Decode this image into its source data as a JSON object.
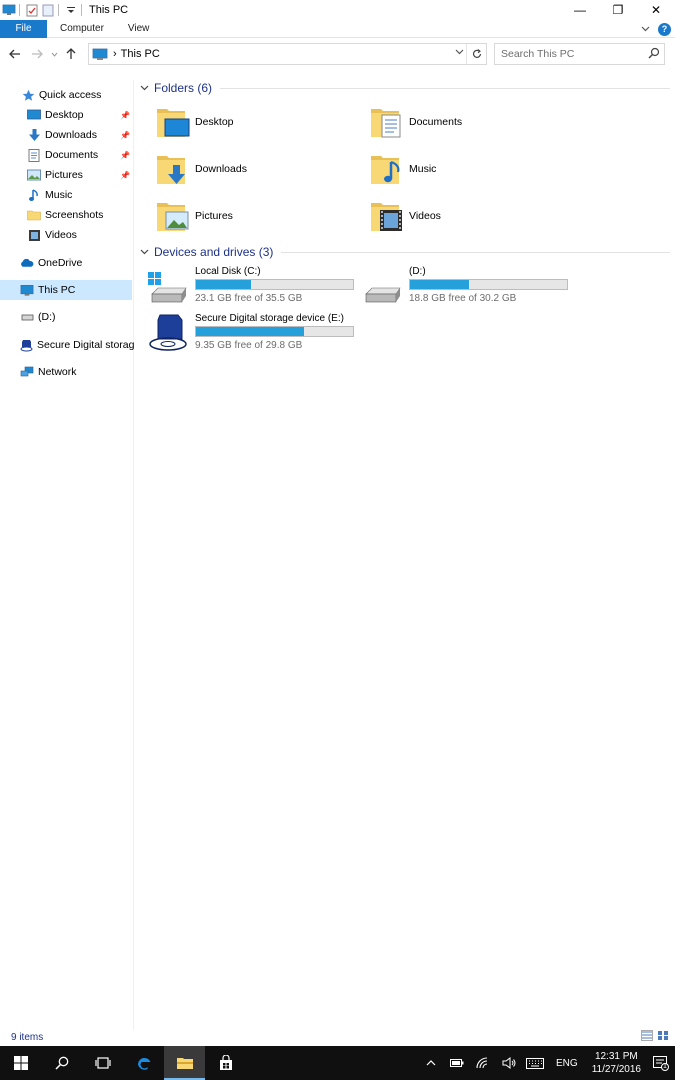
{
  "window": {
    "title": "This PC",
    "minimize_glyph": "—",
    "restore_glyph": "❐",
    "close_glyph": "✕"
  },
  "ribbon": {
    "tabs": [
      "File",
      "Computer",
      "View"
    ]
  },
  "address_bar": {
    "separator": "›",
    "path": "This PC",
    "search_placeholder": "Search This PC"
  },
  "nav_pane": {
    "quick_access": "Quick access",
    "quick_items": [
      {
        "label": "Desktop",
        "icon": "desktop-icon",
        "pinned": true
      },
      {
        "label": "Downloads",
        "icon": "downloads-icon",
        "pinned": true
      },
      {
        "label": "Documents",
        "icon": "documents-icon",
        "pinned": true
      },
      {
        "label": "Pictures",
        "icon": "pictures-icon",
        "pinned": true
      },
      {
        "label": "Music",
        "icon": "music-icon",
        "pinned": false
      },
      {
        "label": "Screenshots",
        "icon": "folder-icon",
        "pinned": false
      },
      {
        "label": "Videos",
        "icon": "videos-icon",
        "pinned": false
      }
    ],
    "onedrive": "OneDrive",
    "this_pc": "This PC",
    "d_drive": "(D:)",
    "sd_storage": "Secure Digital storage",
    "network": "Network"
  },
  "folders_group": {
    "header": "Folders (6)",
    "items": [
      "Desktop",
      "Documents",
      "Downloads",
      "Music",
      "Pictures",
      "Videos"
    ]
  },
  "drives_group": {
    "header": "Devices and drives (3)",
    "drives": [
      {
        "name": "Local Disk (C:)",
        "free": "23.1 GB free of 35.5 GB",
        "used_fraction": 0.35
      },
      {
        "name": "(D:)",
        "free": "18.8 GB free of 30.2 GB",
        "used_fraction": 0.377
      },
      {
        "name": "Secure Digital storage device (E:)",
        "free": "9.35 GB free of 29.8 GB",
        "used_fraction": 0.686
      }
    ]
  },
  "status": {
    "item_count": "9 items"
  },
  "taskbar": {
    "language": "ENG",
    "time": "12:31 PM",
    "date": "11/27/2016",
    "notification_count": "1"
  },
  "colors": {
    "accent": "#1979ca",
    "drive_bar": "#26a0da",
    "group_header": "#1e3287",
    "selection": "#cce8ff",
    "folder_yellow": "#f8d775"
  }
}
